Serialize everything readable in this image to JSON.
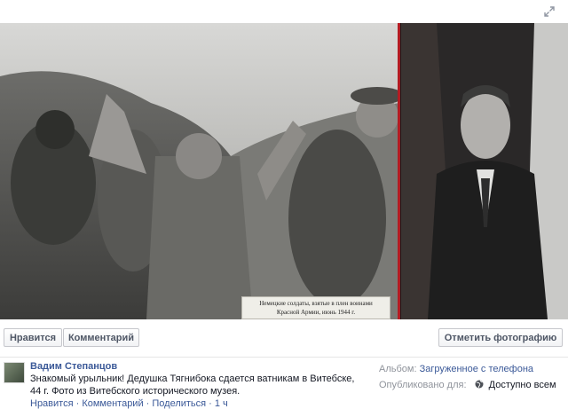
{
  "viewer": {
    "expand_icon": "expand-diagonal-icon"
  },
  "photo": {
    "plaque_text_line1": "Немецкие солдаты, взятые в плен воинами",
    "plaque_text_line2": "Красной Армии, июнь 1944 г.",
    "divider_color": "#b31b22"
  },
  "actions": {
    "like_label": "Нравится",
    "comment_label": "Комментарий",
    "tag_label": "Отметить фотографию"
  },
  "post": {
    "author": "Вадим Степанцов",
    "text": "Знакомый урыльник! Дедушка Тягнибока сдается ватникам в Витебске, 44 г. Фото из Витебского исторического музея.",
    "footer_links": "Нравится · Комментарий · Поделиться · 1 ч"
  },
  "meta": {
    "album_label": "Альбом:",
    "album_value": "Загруженное с телефона",
    "published_label": "Опубликовано для:",
    "audience_icon": "globe-icon",
    "audience_value": "Доступно всем"
  },
  "colors": {
    "link": "#3b5998",
    "button_text": "#4e5665"
  }
}
